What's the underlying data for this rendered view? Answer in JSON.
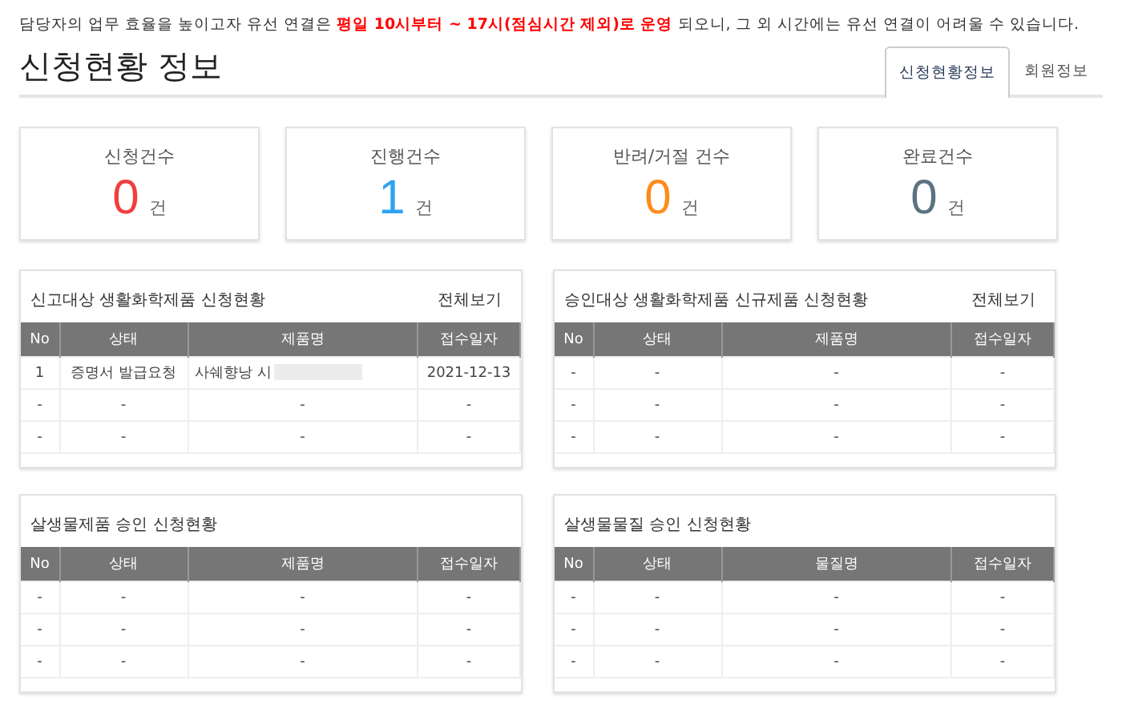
{
  "notice": "담당자의 업무 효율을 높이고자 유선 연결은 **평일 10시부터 ~ 17시(점심시간 제외)로 운영** 되오니, 그 외 시간에는 유선 연결이 어려울 수 있습니다.",
  "page_title": "신청현황 정보",
  "tabs": [
    {
      "label": "신청현황정보",
      "selected": true
    },
    {
      "label": "회원정보",
      "selected": false
    }
  ],
  "stats": [
    {
      "label": "신청건수",
      "count": "0",
      "unit": "건",
      "color": "#f03e3e"
    },
    {
      "label": "진행건수",
      "count": "1",
      "unit": "건",
      "color": "#2ea3f2"
    },
    {
      "label": "반려/거절 건수",
      "count": "0",
      "unit": "건",
      "color": "#fd8c1c"
    },
    {
      "label": "완료건수",
      "count": "0",
      "unit": "건",
      "color": "#5b7380"
    }
  ],
  "panels": [
    {
      "title": "신고대상 생활화학제품 신청현황",
      "link": "전체보기",
      "columns": [
        "No",
        "상태",
        "제품명",
        "접수일자"
      ],
      "rows": [
        {
          "cells": [
            "1",
            "증명서 발급요청",
            "사쉐향낭 시",
            "2021-12-13"
          ],
          "redacted": true
        },
        {
          "cells": [
            "-",
            "-",
            "-",
            "-"
          ],
          "redacted": false
        },
        {
          "cells": [
            "-",
            "-",
            "-",
            "-"
          ],
          "redacted": false
        }
      ]
    },
    {
      "title": "승인대상 생활화학제품 신규제품 신청현황",
      "link": "전체보기",
      "columns": [
        "No",
        "상태",
        "제품명",
        "접수일자"
      ],
      "rows": [
        {
          "cells": [
            "-",
            "-",
            "-",
            "-"
          ],
          "redacted": false
        },
        {
          "cells": [
            "-",
            "-",
            "-",
            "-"
          ],
          "redacted": false
        },
        {
          "cells": [
            "-",
            "-",
            "-",
            "-"
          ],
          "redacted": false
        }
      ]
    },
    {
      "title": "살생물제품 승인 신청현황",
      "columns": [
        "No",
        "상태",
        "제품명",
        "접수일자"
      ],
      "rows": [
        {
          "cells": [
            "-",
            "-",
            "-",
            "-"
          ],
          "redacted": false
        },
        {
          "cells": [
            "-",
            "-",
            "-",
            "-"
          ],
          "redacted": false
        },
        {
          "cells": [
            "-",
            "-",
            "-",
            "-"
          ],
          "redacted": false
        }
      ]
    },
    {
      "title": "살생물물질 승인 신청현황",
      "columns": [
        "No",
        "상태",
        "물질명",
        "접수일자"
      ],
      "rows": [
        {
          "cells": [
            "-",
            "-",
            "-",
            "-"
          ],
          "redacted": false
        },
        {
          "cells": [
            "-",
            "-",
            "-",
            "-"
          ],
          "redacted": false
        },
        {
          "cells": [
            "-",
            "-",
            "-",
            "-"
          ],
          "redacted": false
        }
      ]
    }
  ]
}
